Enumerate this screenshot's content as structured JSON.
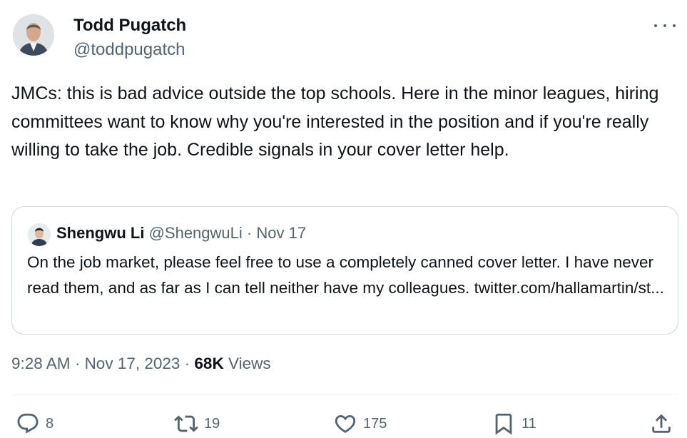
{
  "author": {
    "name": "Todd Pugatch",
    "handle": "@toddpugatch"
  },
  "tweet": {
    "text": "JMCs: this is bad advice outside the top schools. Here in the minor leagues, hiring committees want to know why you're interested in the position and if you're really willing to take the job. Credible signals in your cover letter help."
  },
  "quote": {
    "name": "Shengwu Li",
    "handle": "@ShengwuLi",
    "separator": " · ",
    "date": "Nov 17",
    "text": "On the job market, please feel free to use a completely canned cover letter. I have never read them, and as far as I can tell neither have my colleagues. twitter.com/hallamartin/st..."
  },
  "meta": {
    "time": "9:28 AM",
    "separator": " · ",
    "date": "Nov 17, 2023",
    "views_count": "68K",
    "views_label": "Views"
  },
  "actions": {
    "replies": "8",
    "retweets": "19",
    "likes": "175",
    "bookmarks": "11"
  },
  "icons": {
    "more": "more-horizontal-icon",
    "reply": "reply-bubble-icon",
    "retweet": "retweet-arrows-icon",
    "like": "heart-icon",
    "bookmark": "bookmark-icon",
    "share": "share-upload-icon"
  },
  "colors": {
    "text": "#0f1419",
    "secondary": "#536471",
    "border": "#cfd9de"
  }
}
